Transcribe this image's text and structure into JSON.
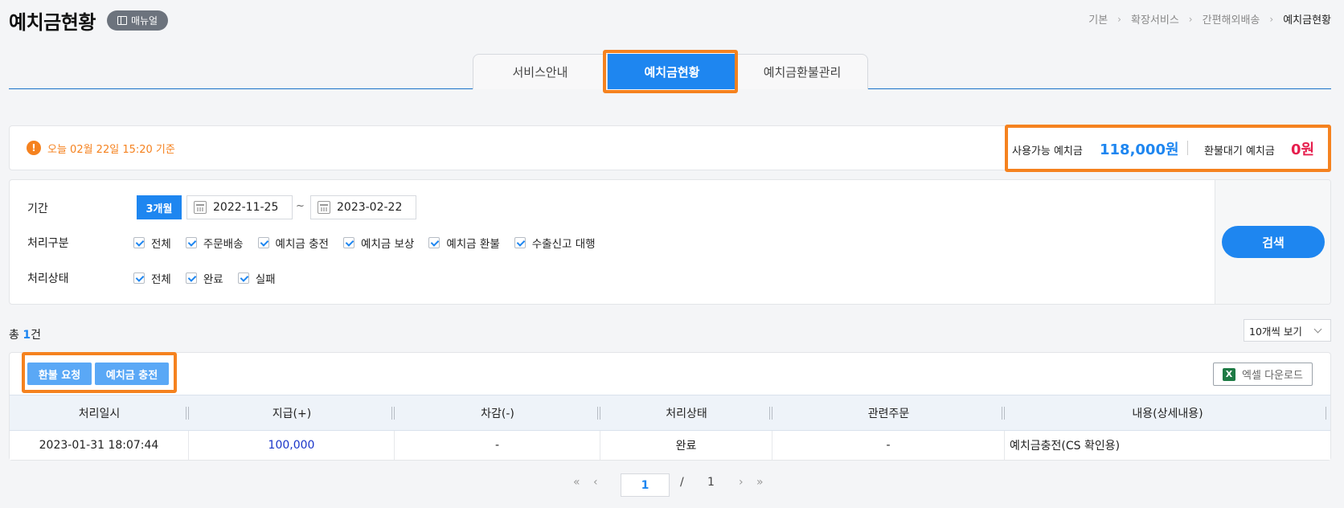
{
  "header": {
    "title": "예치금현황",
    "manual_label": "매뉴얼",
    "breadcrumb": [
      "기본",
      "확장서비스",
      "간편해외배송",
      "예치금현황"
    ]
  },
  "tabs": [
    {
      "label": "서비스안내"
    },
    {
      "label": "예치금현황"
    },
    {
      "label": "예치금환불관리"
    }
  ],
  "info": {
    "notice": "오늘 02월 22일 15:20 기준",
    "available_label": "사용가능 예치금",
    "available_value": "118,000원",
    "pending_label": "환불대기 예치금",
    "pending_value": "0원"
  },
  "search": {
    "period_label": "기간",
    "period_button": "3개월",
    "date_from": "2022-11-25",
    "date_tilde": "~",
    "date_to": "2023-02-22",
    "type_label": "처리구분",
    "type_options": [
      "전체",
      "주문배송",
      "예치금 충전",
      "예치금 보상",
      "예치금 환불",
      "수출신고 대행"
    ],
    "status_label": "처리상태",
    "status_options": [
      "전체",
      "완료",
      "실패"
    ],
    "search_button": "검색"
  },
  "list": {
    "total_prefix": "총 ",
    "total_count": "1",
    "total_suffix": "건",
    "per_page": "10개씩 보기",
    "refund_button": "환불 요청",
    "charge_button": "예치금 충전",
    "excel_button": "엑셀 다운로드",
    "columns": [
      "처리일시",
      "지급(+)",
      "차감(-)",
      "처리상태",
      "관련주문",
      "내용(상세내용)"
    ],
    "rows": [
      [
        "2023-01-31 18:07:44",
        "100,000",
        "-",
        "완료",
        "-",
        "예치금충전(CS 확인용)"
      ]
    ]
  },
  "pagination": {
    "current": "1",
    "separator": "/",
    "total": "1"
  }
}
